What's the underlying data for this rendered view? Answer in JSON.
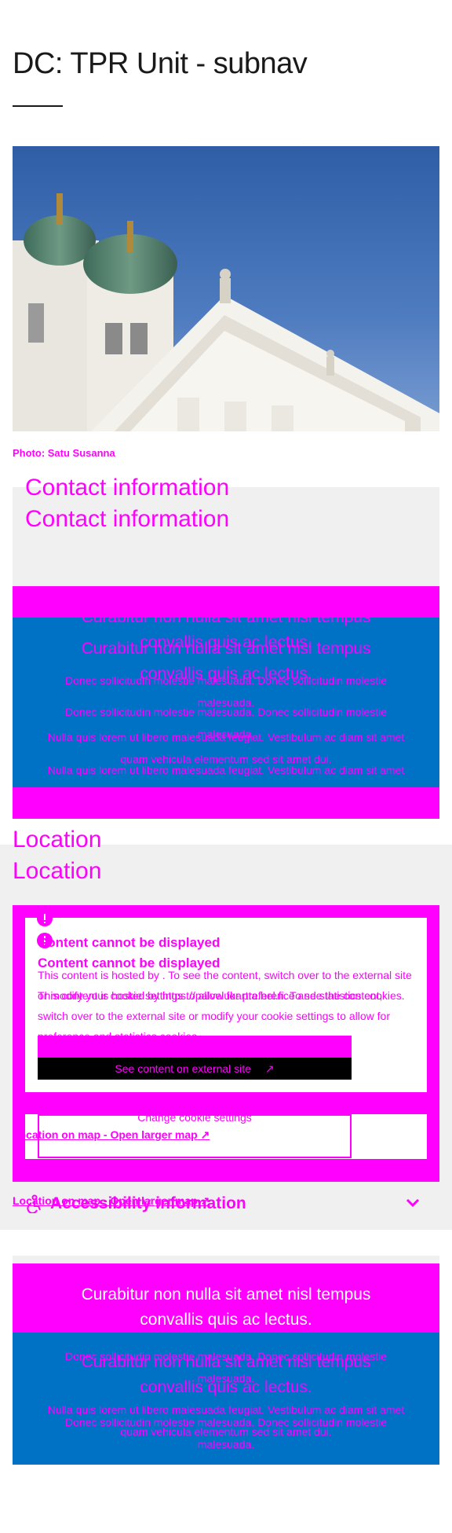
{
  "page": {
    "title": "DC: TPR Unit - subnav"
  },
  "hero": {
    "caption": "Photo: Satu Susanna"
  },
  "contact": {
    "heading": "Contact information",
    "heading_dup": "Contact information",
    "card_title": "Curabitur non nulla sit amet nisl tempus convallis quis ac lectus.",
    "card_title_dup": "Curabitur non nulla sit amet nisl tempus convallis quis ac lectus.",
    "card_body_1": "Donec sollicitudin molestie malesuada. Donec sollicitudin molestie malesuada.",
    "card_body_1_dup": "Donec sollicitudin molestie malesuada. Donec sollicitudin molestie malesuada.",
    "card_body_2": "Nulla quis lorem ut libero malesuada feugiat. Vestibulum ac diam sit amet quam vehicula elementum sed sit amet dui.",
    "card_body_2_dup": "Nulla quis lorem ut libero malesuada feugiat. Vestibulum ac diam sit amet quam vehicula elementum sed sit amet dui."
  },
  "location": {
    "heading": "Location",
    "heading_dup": "Location",
    "notice_title": "Content cannot be displayed",
    "notice_title_dup": "Content cannot be displayed",
    "notice_text": "This content is hosted by . To see the content, switch over to the external site or modify your cookie settings to allow for preference and statistics cookies.",
    "notice_text_dup": "This content is hosted by https://palvelukartta.hel.fi. To see the content, switch over to the external site or modify your cookie settings to allow for preference and statistics cookies.",
    "external_button": "See content on external site",
    "external_button_dup": "See content on external site",
    "cookie_button": "Change cookie settings",
    "map_link": "Location on map - Open larger map",
    "map_link_dup": "Location on map - Open larger map"
  },
  "accessibility": {
    "label": "Accessibility information"
  },
  "bottom_card": {
    "title": "Curabitur non nulla sit amet nisl tempus convallis quis ac lectus.",
    "title_dup": "Curabitur non nulla sit amet nisl tempus convallis quis ac lectus.",
    "body_1": "Donec sollicitudin molestie malesuada. Donec sollicitudin molestie malesuada.",
    "body_1_dup": "Donec sollicitudin molestie malesuada. Donec sollicitudin molestie malesuada.",
    "body_2": "Nulla quis lorem ut libero malesuada feugiat. Vestibulum ac diam sit amet quam vehicula elementum sed sit amet dui."
  },
  "colors": {
    "missing_style": "#ff00ff",
    "card_blue": "#0072c6",
    "panel_grey": "#f0f0f0"
  },
  "icons": {
    "alert": "alert-circle-icon",
    "external": "external-link-icon",
    "accessibility": "accessibility-icon",
    "chevron": "chevron-down-icon"
  }
}
